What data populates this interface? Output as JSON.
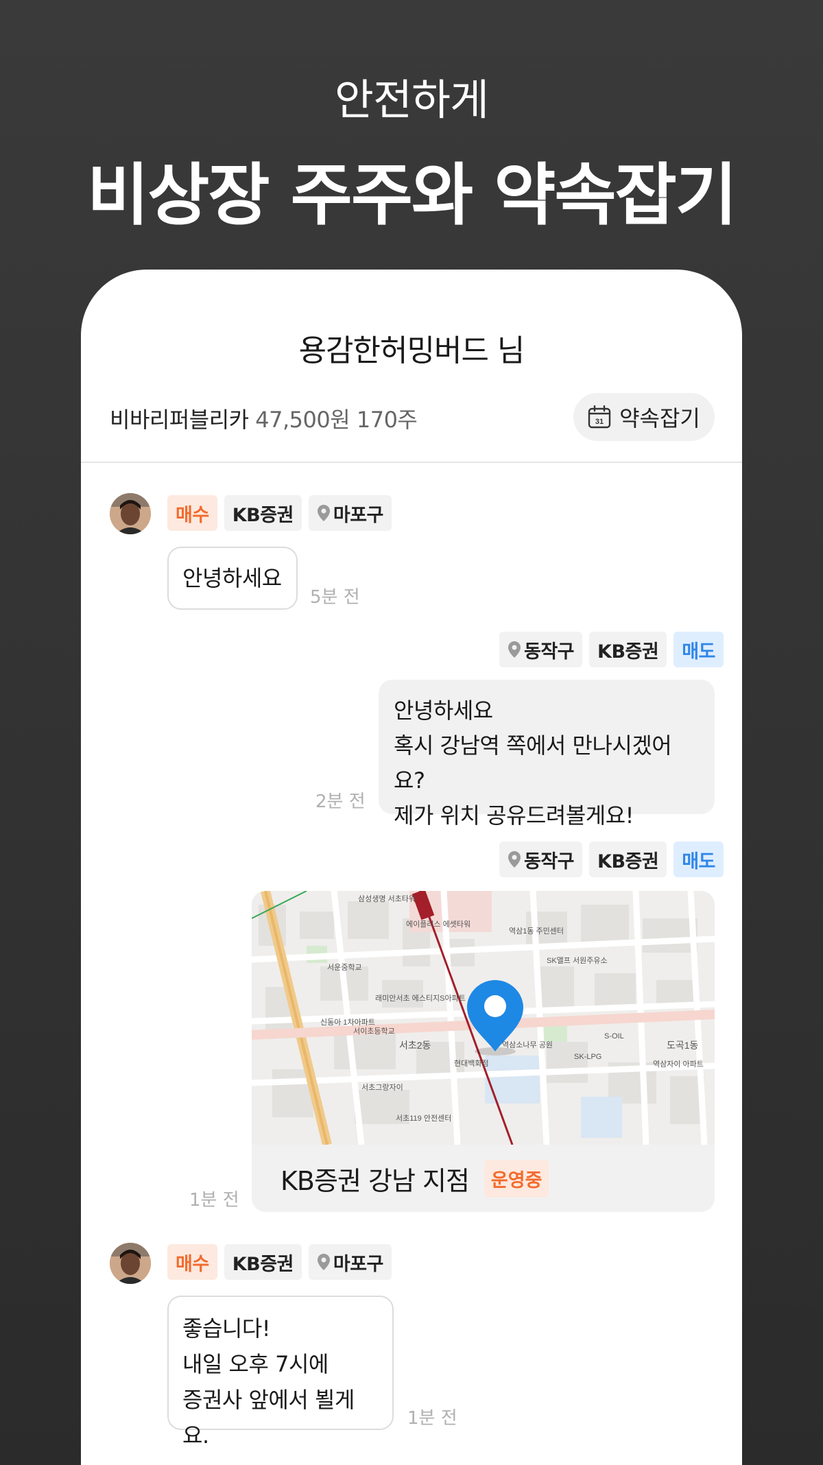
{
  "hero": {
    "subtitle": "안전하게",
    "title": "비상장 주주와 약속잡기"
  },
  "chat_header": {
    "title": "용감한허밍버드 님",
    "stock_name": "비바리퍼블리카",
    "stock_detail": "47,500원 170주",
    "appointment_button": "약속잡기",
    "calendar_day": "31"
  },
  "messages": [
    {
      "side": "left",
      "tags": {
        "type": "매수",
        "broker": "KB증권",
        "region": "마포구"
      },
      "lines": [
        "안녕하세요"
      ],
      "time": "5분 전"
    },
    {
      "side": "right",
      "tags": {
        "type": "매도",
        "broker": "KB증권",
        "region": "동작구"
      },
      "lines": [
        "안녕하세요",
        "혹시 강남역 쪽에서 만나시겠어요?",
        "제가 위치 공유드려볼게요!"
      ],
      "time": "2분 전"
    },
    {
      "side": "right",
      "tags": {
        "type": "매도",
        "broker": "KB증권",
        "region": "동작구"
      },
      "map": {
        "place_name": "KB증권 강남 지점",
        "status": "운영중",
        "labels": [
          "서초2동",
          "도곡1동",
          "서운중학교",
          "역삼1동 주민센터",
          "SK앨프 서원주유소",
          "서이초등학교",
          "래미안서초 에스티지S아파트",
          "현대백화점",
          "역삼소나무 공원",
          "S-OIL",
          "SK-LPG",
          "서초119 안전센터",
          "서초그랑자이",
          "역삼자이 아파트",
          "삼성생명 서초타워",
          "에이플러스 에셋타워",
          "신동아 1차아파트"
        ]
      },
      "time": "1분 전"
    },
    {
      "side": "left",
      "tags": {
        "type": "매수",
        "broker": "KB증권",
        "region": "마포구"
      },
      "lines": [
        "좋습니다!",
        "내일 오후 7시에",
        "증권사 앞에서 뵐게요."
      ],
      "time": "1분 전"
    }
  ],
  "colors": {
    "background": "#2f2f2f",
    "buy_tag_text": "#f26b2e",
    "buy_tag_bg": "#fde9df",
    "sell_tag_text": "#2f86e8",
    "sell_tag_bg": "#dfeeff",
    "map_pin": "#1e88e5"
  }
}
